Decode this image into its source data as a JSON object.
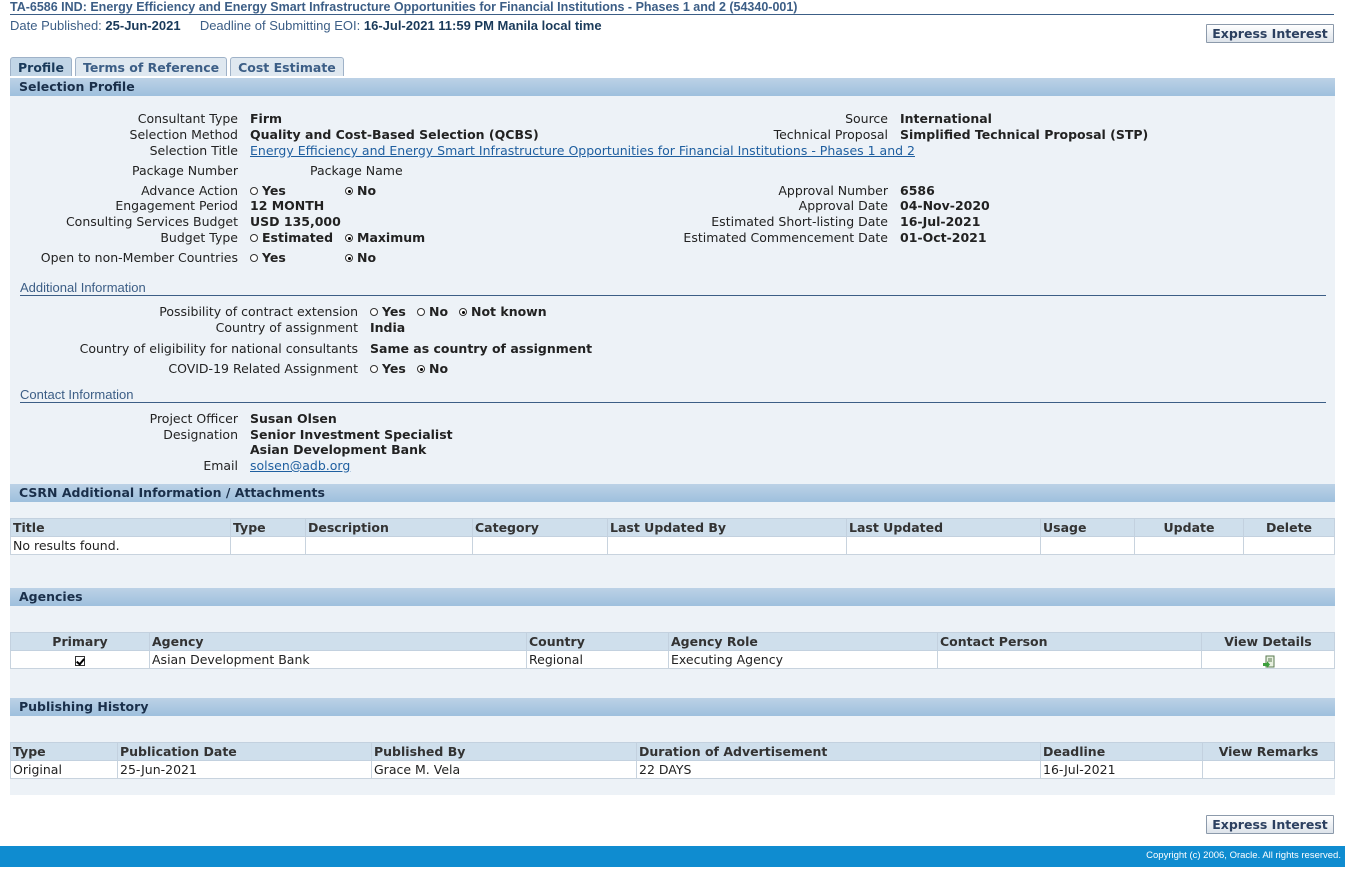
{
  "page": {
    "title": "TA-6586 IND: Energy Efficiency and Energy Smart Infrastructure Opportunities for Financial Institutions - Phases 1 and 2 (54340-001)",
    "date_published_label": "Date Published:",
    "date_published": "25-Jun-2021",
    "deadline_label": "Deadline of Submitting EOI:",
    "deadline": "16-Jul-2021 11:59 PM Manila local time",
    "express_interest": "Express Interest"
  },
  "tabs": [
    {
      "label": "Profile",
      "active": true
    },
    {
      "label": "Terms of Reference",
      "active": false
    },
    {
      "label": "Cost Estimate",
      "active": false
    }
  ],
  "selection_profile": {
    "header": "Selection Profile",
    "consultant_type_label": "Consultant Type",
    "consultant_type": "Firm",
    "selection_method_label": "Selection Method",
    "selection_method": "Quality and Cost-Based Selection (QCBS)",
    "selection_title_label": "Selection Title",
    "selection_title": "Energy Efficiency and Energy Smart Infrastructure Opportunities for Financial Institutions - Phases 1 and 2",
    "package_number_label": "Package Number",
    "package_name_label": "Package Name",
    "advance_action_label": "Advance Action",
    "engagement_period_label": "Engagement Period",
    "engagement_period": "12 MONTH",
    "budget_label": "Consulting Services Budget",
    "budget": "USD 135,000",
    "budget_type_label": "Budget Type",
    "budget_type_estimated": "Estimated",
    "budget_type_maximum": "Maximum",
    "non_member_label": "Open to non-Member Countries",
    "yes": "Yes",
    "no": "No",
    "not_known": "Not known",
    "source_label": "Source",
    "source": "International",
    "technical_proposal_label": "Technical Proposal",
    "technical_proposal": "Simplified Technical Proposal (STP)",
    "approval_number_label": "Approval Number",
    "approval_number": "6586",
    "approval_date_label": "Approval Date",
    "approval_date": "04-Nov-2020",
    "shortlisting_label": "Estimated Short-listing Date",
    "shortlisting": "16-Jul-2021",
    "commencement_label": "Estimated Commencement Date",
    "commencement": "01-Oct-2021"
  },
  "additional_info": {
    "header": "Additional Information",
    "extension_label": "Possibility of contract extension",
    "country_label": "Country of assignment",
    "country": "India",
    "eligibility_label": "Country of eligibility for national consultants",
    "eligibility": "Same as country of assignment",
    "covid_label": "COVID-19 Related Assignment"
  },
  "contact": {
    "header": "Contact Information",
    "officer_label": "Project Officer",
    "officer": "Susan Olsen",
    "designation_label": "Designation",
    "designation": "Senior Investment Specialist",
    "organization": "Asian Development Bank",
    "email_label": "Email",
    "email": "solsen@adb.org"
  },
  "attachments": {
    "header": "CSRN Additional Information / Attachments",
    "columns": [
      "Title",
      "Type",
      "Description",
      "Category",
      "Last Updated By",
      "Last Updated",
      "Usage",
      "Update",
      "Delete"
    ],
    "empty": "No results found."
  },
  "agencies": {
    "header": "Agencies",
    "columns": [
      "Primary",
      "Agency",
      "Country",
      "Agency Role",
      "Contact Person",
      "View Details"
    ],
    "rows": [
      {
        "primary": true,
        "agency": "Asian Development Bank",
        "country": "Regional",
        "role": "Executing Agency",
        "contact": ""
      }
    ]
  },
  "publishing": {
    "header": "Publishing History",
    "columns": [
      "Type",
      "Publication Date",
      "Published By",
      "Duration of Advertisement",
      "Deadline",
      "View Remarks"
    ],
    "rows": [
      {
        "type": "Original",
        "date": "25-Jun-2021",
        "by": "Grace M. Vela",
        "duration": "22 DAYS",
        "deadline": "16-Jul-2021",
        "remarks": ""
      }
    ]
  },
  "footer": {
    "copyright": "Copyright (c) 2006, Oracle. All rights reserved."
  },
  "colors": {
    "footer_bar": "#0f8cd0",
    "header_bar": "#9ec0dd",
    "panel": "#edf2f7",
    "link": "#1f5fa0"
  }
}
